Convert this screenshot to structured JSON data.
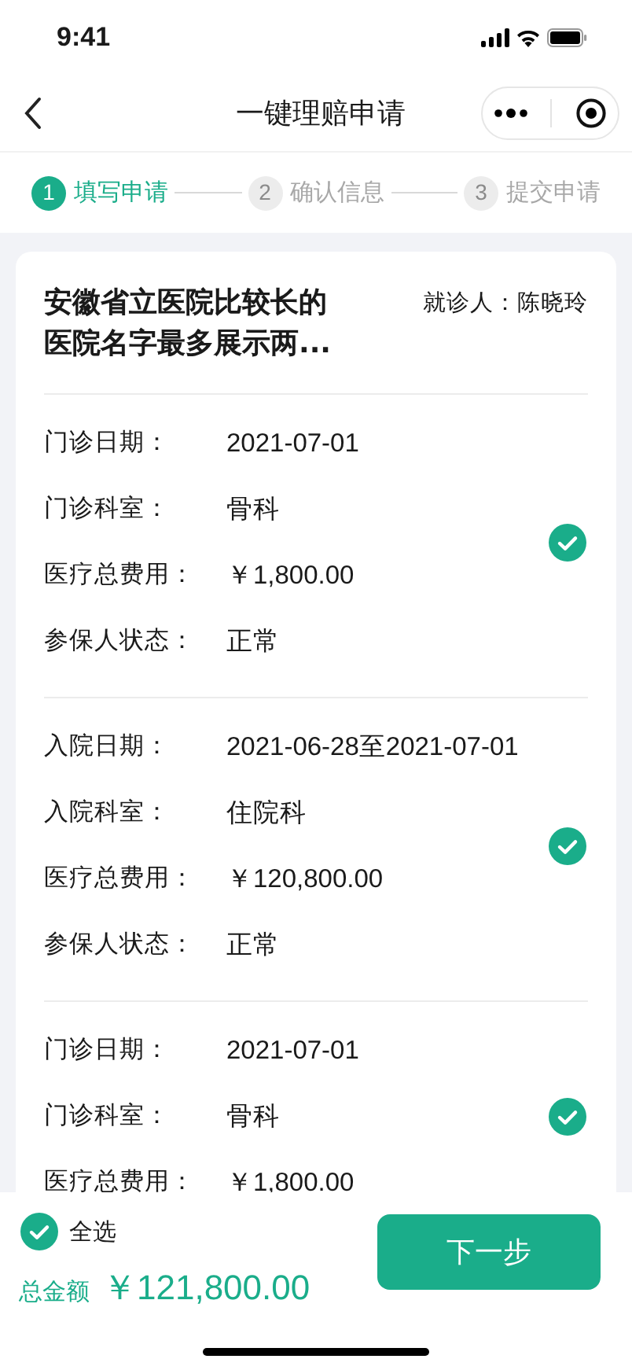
{
  "status_bar": {
    "time": "9:41"
  },
  "nav": {
    "title": "一键理赔申请"
  },
  "steps": [
    {
      "number": "1",
      "label": "填写申请",
      "selected": true
    },
    {
      "number": "2",
      "label": "确认信息",
      "selected": false
    },
    {
      "number": "3",
      "label": "提交申请",
      "selected": false
    }
  ],
  "hospital": {
    "name": "安徽省立医院比较长的医院名字最多展示两...",
    "patient_label": "就诊人：",
    "patient": "陈晓玲"
  },
  "records": [
    {
      "checked": true,
      "fields": [
        {
          "label": "门诊日期：",
          "value": "2021-07-01"
        },
        {
          "label": "门诊科室：",
          "value": "骨科"
        },
        {
          "label": "医疗总费用：",
          "value": "￥1,800.00"
        },
        {
          "label": "参保人状态：",
          "value": "正常"
        }
      ]
    },
    {
      "checked": true,
      "fields": [
        {
          "label": "入院日期：",
          "value": "2021-06-28至2021-07-01"
        },
        {
          "label": "入院科室：",
          "value": "住院科"
        },
        {
          "label": "医疗总费用：",
          "value": "￥120,800.00"
        },
        {
          "label": "参保人状态：",
          "value": "正常"
        }
      ]
    },
    {
      "checked": true,
      "fields": [
        {
          "label": "门诊日期：",
          "value": "2021-07-01"
        },
        {
          "label": "门诊科室：",
          "value": "骨科"
        },
        {
          "label": "医疗总费用：",
          "value": "￥1,800.00"
        }
      ]
    }
  ],
  "footer": {
    "select_all": {
      "label": "全选",
      "checked": true
    },
    "total_label": "总金额",
    "total": "￥121,800.00",
    "next_button": "下一步"
  }
}
